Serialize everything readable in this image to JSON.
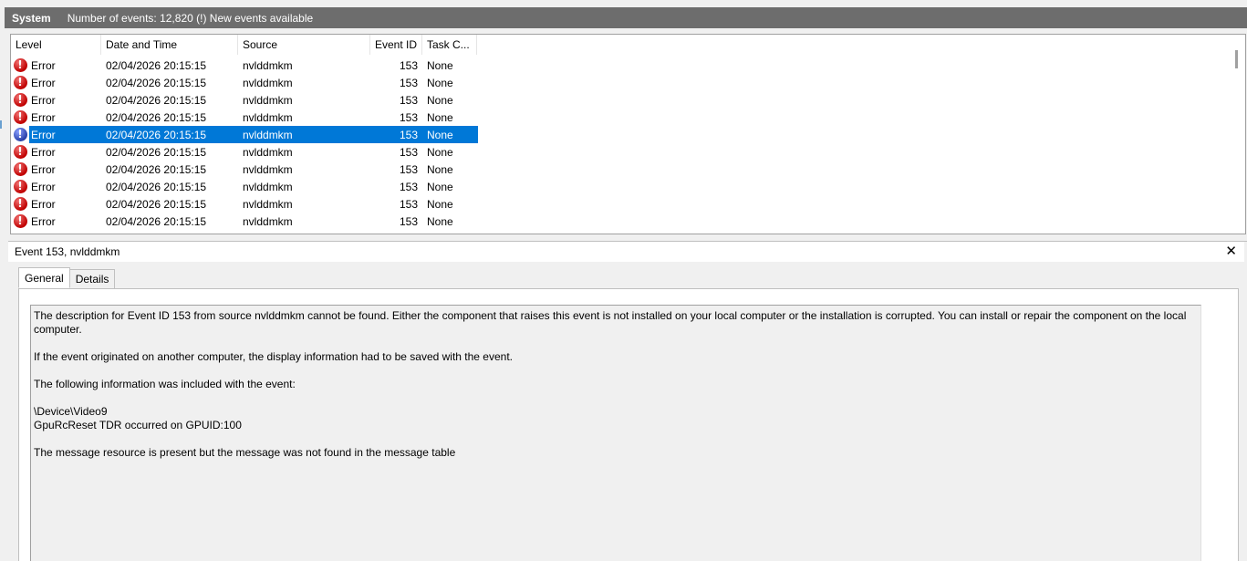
{
  "titlebar": {
    "title": "System",
    "info": "Number of events: 12,820 (!) New events available"
  },
  "list": {
    "columns": {
      "level": "Level",
      "date": "Date and Time",
      "source": "Source",
      "event_id": "Event ID",
      "task": "Task C..."
    },
    "rows": [
      {
        "level": "Error",
        "date": "02/04/2026 20:15:15",
        "source": "nvlddmkm",
        "event_id": "153",
        "task": "None"
      },
      {
        "level": "Error",
        "date": "02/04/2026 20:15:15",
        "source": "nvlddmkm",
        "event_id": "153",
        "task": "None"
      },
      {
        "level": "Error",
        "date": "02/04/2026 20:15:15",
        "source": "nvlddmkm",
        "event_id": "153",
        "task": "None"
      },
      {
        "level": "Error",
        "date": "02/04/2026 20:15:15",
        "source": "nvlddmkm",
        "event_id": "153",
        "task": "None"
      },
      {
        "level": "Error",
        "date": "02/04/2026 20:15:15",
        "source": "nvlddmkm",
        "event_id": "153",
        "task": "None",
        "selected": true
      },
      {
        "level": "Error",
        "date": "02/04/2026 20:15:15",
        "source": "nvlddmkm",
        "event_id": "153",
        "task": "None"
      },
      {
        "level": "Error",
        "date": "02/04/2026 20:15:15",
        "source": "nvlddmkm",
        "event_id": "153",
        "task": "None"
      },
      {
        "level": "Error",
        "date": "02/04/2026 20:15:15",
        "source": "nvlddmkm",
        "event_id": "153",
        "task": "None"
      },
      {
        "level": "Error",
        "date": "02/04/2026 20:15:15",
        "source": "nvlddmkm",
        "event_id": "153",
        "task": "None"
      },
      {
        "level": "Error",
        "date": "02/04/2026 20:15:15",
        "source": "nvlddmkm",
        "event_id": "153",
        "task": "None"
      }
    ],
    "error_icon_glyph": "!",
    "icon": "error-icon"
  },
  "detail": {
    "title": "Event 153, nvlddmkm",
    "close_glyph": "✕",
    "tabs": [
      "General",
      "Details"
    ],
    "description": [
      "The description for Event ID 153 from source nvlddmkm cannot be found. Either the component that raises this event is not installed on your local computer or the installation is corrupted. You can install or repair the component on the local computer.",
      "If the event originated on another computer, the display information had to be saved with the event.",
      "The following information was included with the event:",
      "\\Device\\Video9\nGpuRcReset TDR occurred on GPUID:100",
      "The message resource is present but the message was not found in the message table"
    ]
  },
  "colors": {
    "titlebar_bg": "#6d6d6d",
    "selection": "#0078d7",
    "error_red": "#c00000"
  }
}
